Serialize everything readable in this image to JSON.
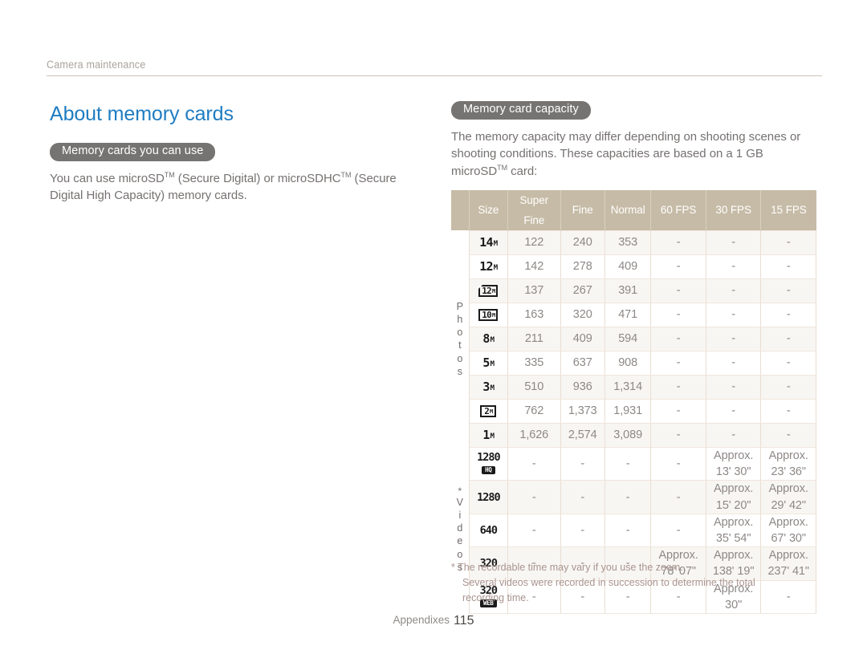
{
  "running_head": "Camera maintenance",
  "page_title": "About memory cards",
  "left": {
    "badge": "Memory cards you can use",
    "paragraph_parts": {
      "a": "You can use microSD",
      "tm1": "TM",
      "b": " (Secure Digital) or microSDHC",
      "tm2": "TM",
      "c": " (Secure Digital High Capacity) memory cards."
    }
  },
  "right": {
    "badge": "Memory card capacity",
    "paragraph_parts": {
      "a": "The memory capacity may differ depending on shooting scenes or shooting conditions. These capacities are based on a 1 GB microSD",
      "tm1": "TM",
      "b": " card:"
    }
  },
  "table": {
    "headers": [
      "Size",
      "Super Fine",
      "Fine",
      "Normal",
      "60 FPS",
      "30 FPS",
      "15 FPS"
    ],
    "groups": [
      {
        "label": "Photos",
        "starred": false,
        "rows": [
          {
            "icon": {
              "style": "plain",
              "num": "14",
              "unit": "M"
            },
            "cells": [
              "122",
              "240",
              "353",
              "-",
              "-",
              "-"
            ]
          },
          {
            "icon": {
              "style": "plain",
              "num": "12",
              "unit": "M"
            },
            "cells": [
              "142",
              "278",
              "409",
              "-",
              "-",
              "-"
            ]
          },
          {
            "icon": {
              "style": "notch",
              "num": "12",
              "unit": "M"
            },
            "cells": [
              "137",
              "267",
              "391",
              "-",
              "-",
              "-"
            ]
          },
          {
            "icon": {
              "style": "box",
              "num": "10",
              "unit": "M"
            },
            "cells": [
              "163",
              "320",
              "471",
              "-",
              "-",
              "-"
            ]
          },
          {
            "icon": {
              "style": "plain",
              "num": "8",
              "unit": "M"
            },
            "cells": [
              "211",
              "409",
              "594",
              "-",
              "-",
              "-"
            ]
          },
          {
            "icon": {
              "style": "plain",
              "num": "5",
              "unit": "M"
            },
            "cells": [
              "335",
              "637",
              "908",
              "-",
              "-",
              "-"
            ]
          },
          {
            "icon": {
              "style": "plain",
              "num": "3",
              "unit": "M"
            },
            "cells": [
              "510",
              "936",
              "1,314",
              "-",
              "-",
              "-"
            ]
          },
          {
            "icon": {
              "style": "wide",
              "num": "2",
              "unit": "M"
            },
            "cells": [
              "762",
              "1,373",
              "1,931",
              "-",
              "-",
              "-"
            ]
          },
          {
            "icon": {
              "style": "plain",
              "num": "1",
              "unit": "M"
            },
            "cells": [
              "1,626",
              "2,574",
              "3,089",
              "-",
              "-",
              "-"
            ]
          }
        ]
      },
      {
        "label": "Videos",
        "starred": true,
        "rows": [
          {
            "icon": {
              "style": "stack",
              "num": "1280",
              "tag": "HQ"
            },
            "cells": [
              "-",
              "-",
              "-",
              "-",
              "Approx.\n13' 30\"",
              "Approx.\n23' 36\""
            ]
          },
          {
            "icon": {
              "style": "big",
              "num": "1280"
            },
            "cells": [
              "-",
              "-",
              "-",
              "-",
              "Approx.\n15' 20\"",
              "Approx.\n29' 42\""
            ]
          },
          {
            "icon": {
              "style": "big",
              "num": "640"
            },
            "cells": [
              "-",
              "-",
              "-",
              "-",
              "Approx.\n35' 54\"",
              "Approx.\n67' 30\""
            ]
          },
          {
            "icon": {
              "style": "big",
              "num": "320"
            },
            "cells": [
              "-",
              "-",
              "-",
              "Approx.\n78' 07\"",
              "Approx.\n138' 19\"",
              "Approx.\n237' 41\""
            ]
          },
          {
            "icon": {
              "style": "stack",
              "num": "320",
              "tag": "WEB"
            },
            "cells": [
              "-",
              "-",
              "-",
              "-",
              "Approx.\n30\"",
              "-"
            ]
          }
        ]
      }
    ]
  },
  "footnote": {
    "line1": "* The recordable time may vary if you use the zoom.",
    "line2": "Several videos were recorded in succession to determine the total",
    "line3": "recording time."
  },
  "footer": {
    "label": "Appendixes",
    "page_number": "115"
  },
  "colors": {
    "heading_blue": "#1f7cc2",
    "badge_gray": "#767472",
    "table_header_tan": "#c6bba6",
    "row_tint": "#f8f6f3",
    "footnote_mauve": "#a9948f"
  }
}
